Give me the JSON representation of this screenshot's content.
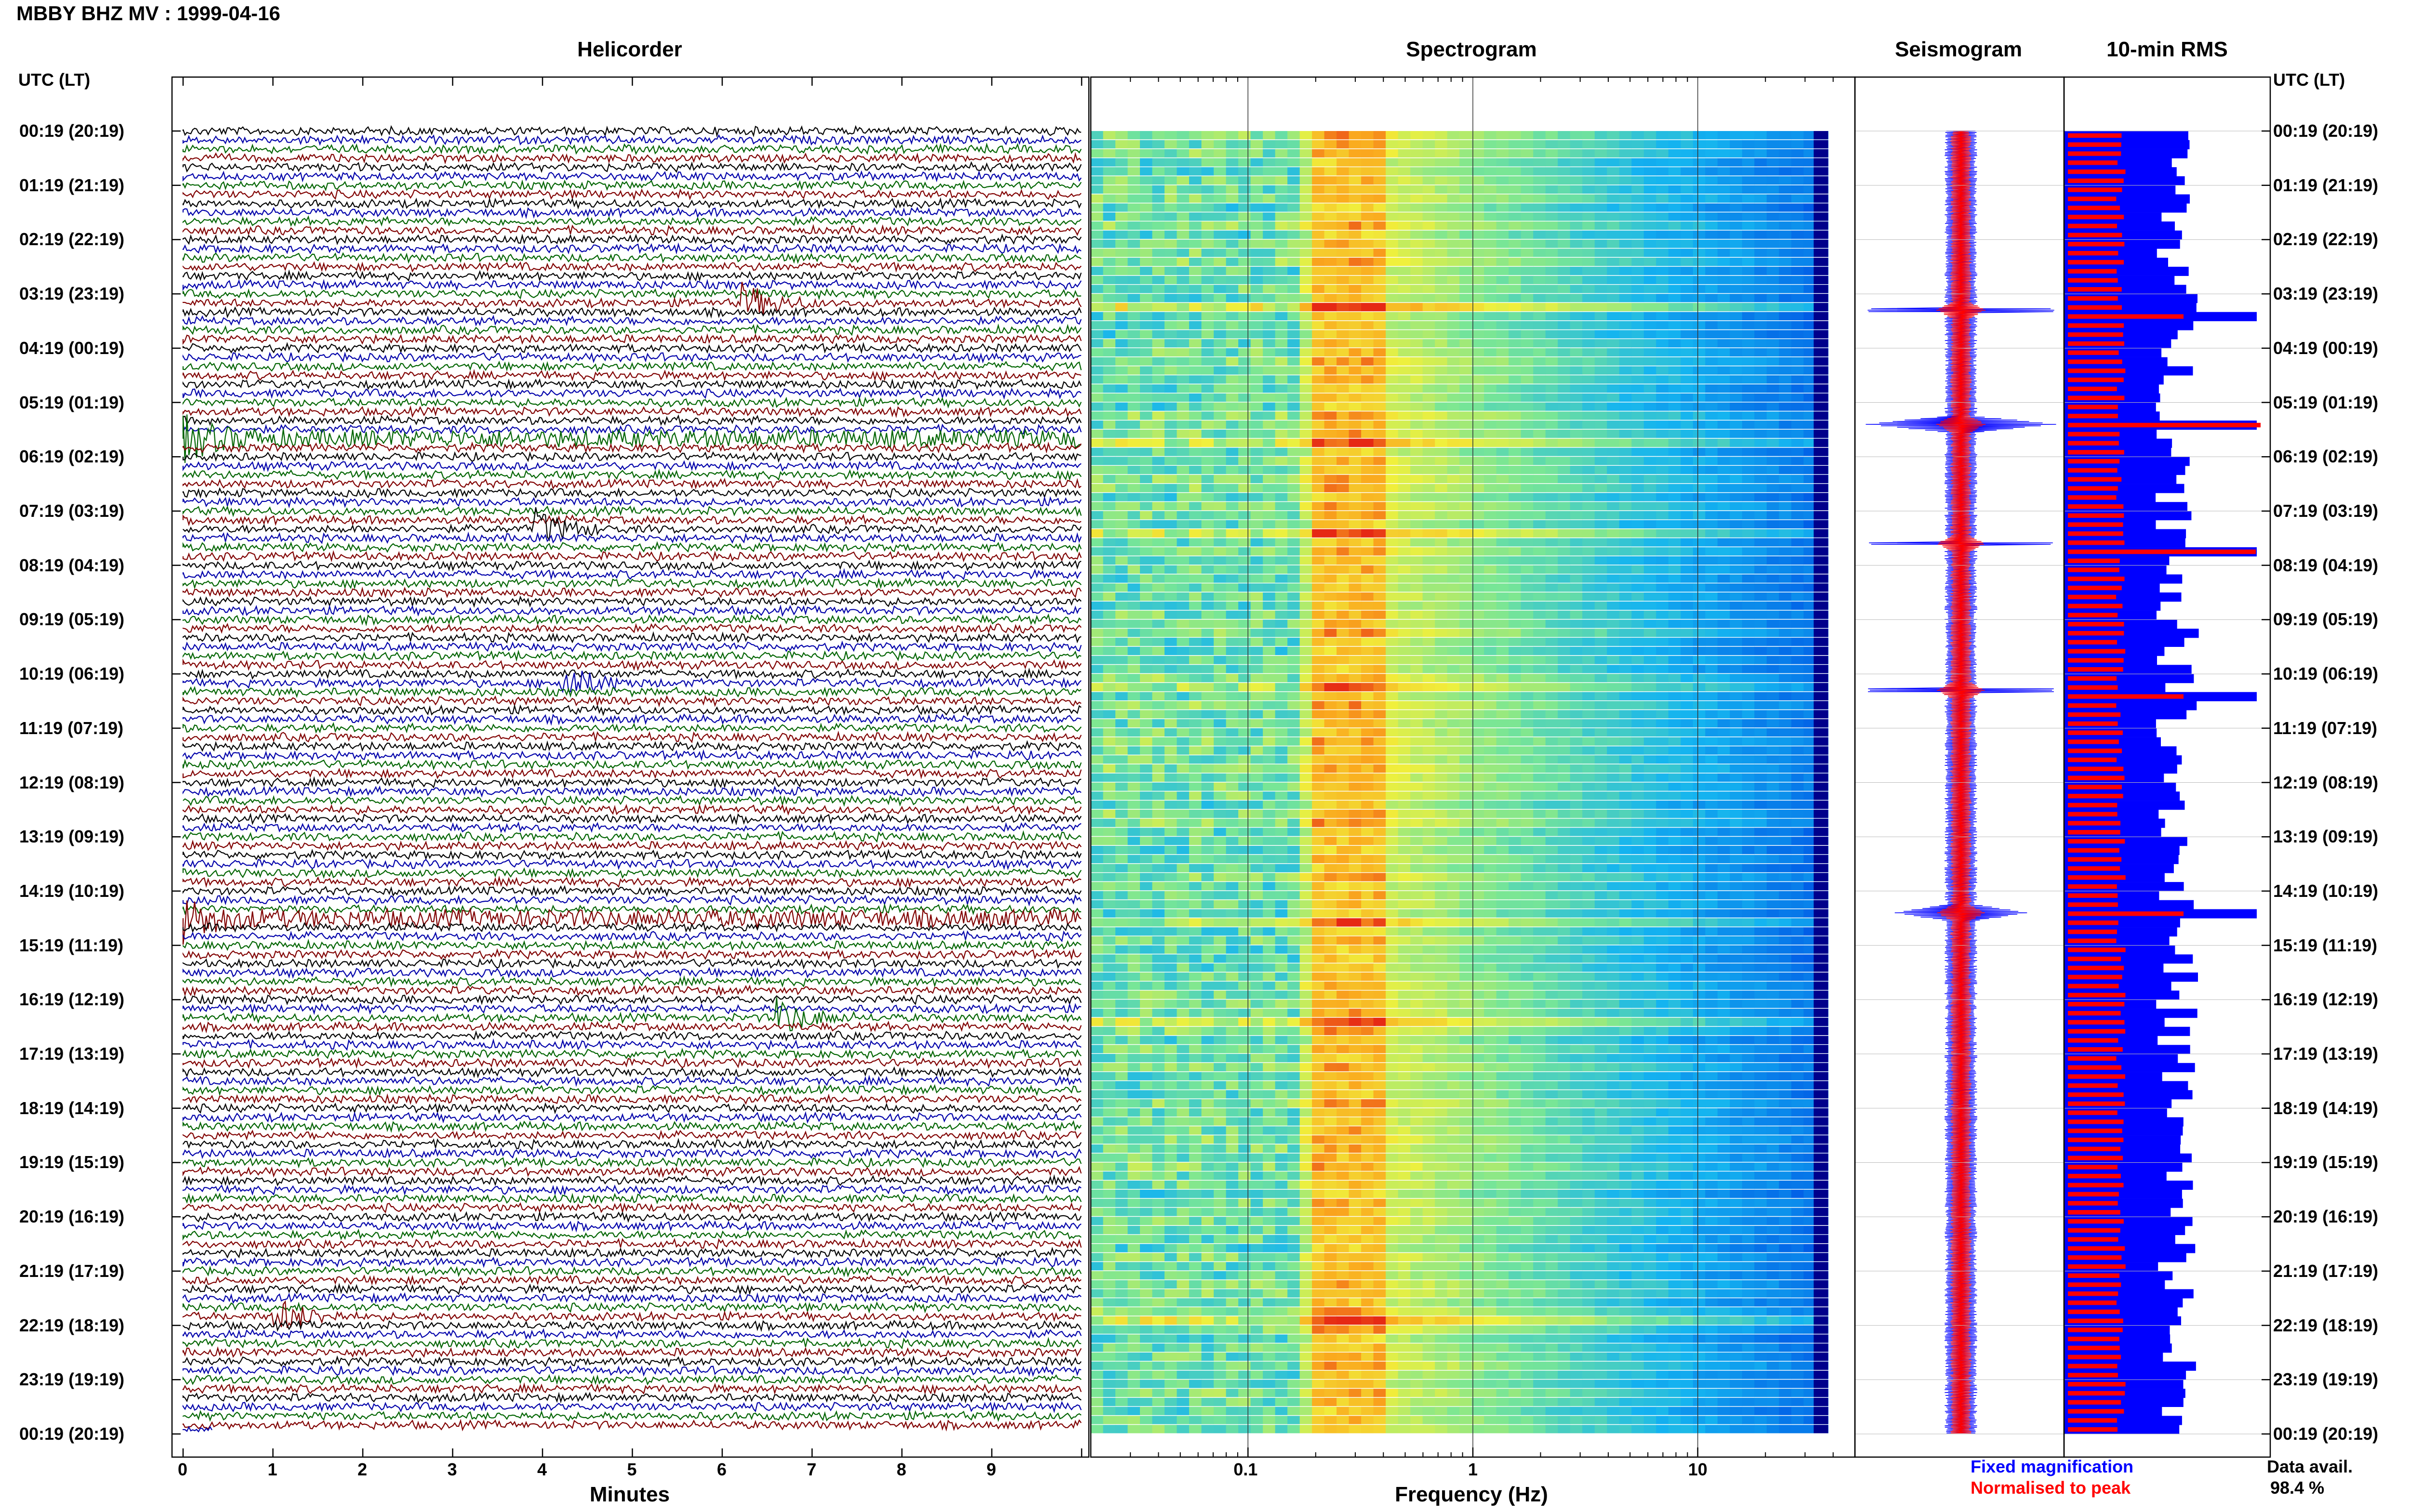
{
  "page": {
    "title": "MBBY BHZ MV : 1999-04-16",
    "left_header": "UTC (LT)",
    "right_header": "UTC (LT)"
  },
  "panels": {
    "helicorder": {
      "title": "Helicorder",
      "xlabel": "Minutes"
    },
    "spectrogram": {
      "title": "Spectrogram",
      "xlabel": "Frequency (Hz)"
    },
    "seismogram": {
      "title": "Seismogram"
    },
    "rms": {
      "title": "10-min RMS"
    }
  },
  "legend": {
    "fixed": "Fixed magnification",
    "normalised": "Normalised to peak",
    "fixed_color": "#0000ff",
    "normalised_color": "#ff0000"
  },
  "availability": {
    "label": "Data avail.",
    "value": "98.4 %"
  },
  "colors": {
    "trace_cycle": [
      "#000000",
      "#0000aa",
      "#006400",
      "#800000"
    ],
    "seismo": "#0000ff",
    "seismo_norm": "#ff0000",
    "rms_fixed": "#0000ff",
    "rms_norm": "#ff0000"
  },
  "chart_data": [
    {
      "type": "line",
      "panel": "Helicorder",
      "xlabel": "Minutes",
      "xlim": [
        0,
        10
      ],
      "x_ticks": [
        "0",
        "1",
        "2",
        "3",
        "4",
        "5",
        "6",
        "7",
        "8",
        "9"
      ],
      "y_tick_labels": [
        "00:19 (20:19)",
        "01:19 (21:19)",
        "02:19 (22:19)",
        "03:19 (23:19)",
        "04:19 (00:19)",
        "05:19 (01:19)",
        "06:19 (02:19)",
        "07:19 (03:19)",
        "08:19 (04:19)",
        "09:19 (05:19)",
        "10:19 (06:19)",
        "11:19 (07:19)",
        "12:19 (08:19)",
        "13:19 (09:19)",
        "14:19 (10:19)",
        "15:19 (11:19)",
        "16:19 (12:19)",
        "17:19 (13:19)",
        "18:19 (14:19)",
        "19:19 (15:19)",
        "20:19 (16:19)",
        "21:19 (17:19)",
        "22:19 (18:19)",
        "23:19 (19:19)",
        "00:19 (20:19)"
      ],
      "lines_per_hour": 6,
      "events": [
        {
          "hour": 3.1,
          "minute": 6.2
        },
        {
          "hour": 5.6,
          "minute": 0.0
        },
        {
          "hour": 7.3,
          "minute": 3.9
        },
        {
          "hour": 10.1,
          "minute": 4.2
        },
        {
          "hour": 14.5,
          "minute": 0.0
        },
        {
          "hour": 16.4,
          "minute": 6.6
        },
        {
          "hour": 21.9,
          "minute": 1.0
        }
      ]
    },
    {
      "type": "heatmap",
      "panel": "Spectrogram",
      "xlabel": "Frequency (Hz)",
      "x_scale": "log",
      "xlim": [
        0.02,
        50
      ],
      "x_ticks": [
        "0.1",
        "1",
        "10"
      ],
      "peak_band_hz": [
        0.2,
        0.4
      ]
    },
    {
      "type": "line",
      "panel": "Seismogram",
      "series": [
        {
          "name": "Fixed magnification"
        },
        {
          "name": "Normalised to peak"
        }
      ]
    },
    {
      "type": "bar",
      "panel": "10-min RMS",
      "orientation": "horizontal",
      "series": [
        {
          "name": "Fixed magnification"
        },
        {
          "name": "Normalised to peak"
        }
      ],
      "spikes_hour": [
        3.3,
        5.4,
        7.6,
        10.3,
        14.4
      ]
    }
  ]
}
